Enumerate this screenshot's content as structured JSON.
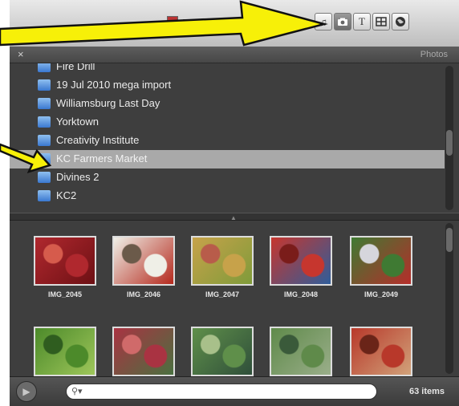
{
  "toolbar": {
    "level_meter": {
      "peak_color": "#b33333",
      "fill_color": "#2fa02f",
      "level_percent": 52
    },
    "tabs": [
      {
        "name": "music-tab",
        "icon": "music-note-icon",
        "active": false
      },
      {
        "name": "photos-tab",
        "icon": "camera-icon",
        "active": true
      },
      {
        "name": "titles-tab",
        "icon": "text-icon",
        "label": "T",
        "active": false
      },
      {
        "name": "transitions-tab",
        "icon": "transition-icon",
        "active": false
      },
      {
        "name": "maps-tab",
        "icon": "globe-icon",
        "active": false
      }
    ]
  },
  "header": {
    "close_label": "×",
    "title": "Photos"
  },
  "albums": [
    {
      "label": "Fire Drill",
      "selected": false
    },
    {
      "label": "19 Jul 2010 mega import",
      "selected": false
    },
    {
      "label": "Williamsburg Last Day",
      "selected": false
    },
    {
      "label": "Yorktown",
      "selected": false
    },
    {
      "label": "Creativity Institute",
      "selected": false
    },
    {
      "label": "KC Farmers Market",
      "selected": true
    },
    {
      "label": "Divines 2",
      "selected": false
    },
    {
      "label": "KC2",
      "selected": false
    }
  ],
  "photos": [
    {
      "label": "IMG_2045",
      "colors": [
        "#b0282e",
        "#6d1014",
        "#d65b4c"
      ]
    },
    {
      "label": "IMG_2046",
      "colors": [
        "#efefe7",
        "#b5291d",
        "#6b5a4a"
      ]
    },
    {
      "label": "IMG_2047",
      "colors": [
        "#c7a24a",
        "#7f9b3a",
        "#b85c4a"
      ]
    },
    {
      "label": "IMG_2048",
      "colors": [
        "#c6362e",
        "#2f5d9a",
        "#7a1c1a"
      ]
    },
    {
      "label": "IMG_2049",
      "colors": [
        "#3f7a33",
        "#b52d2a",
        "#d6d6dc"
      ]
    },
    {
      "label": "",
      "colors": [
        "#4c8a2a",
        "#9ec65a",
        "#2f5d1f"
      ]
    },
    {
      "label": "",
      "colors": [
        "#a93342",
        "#4a7040",
        "#d06a6a"
      ]
    },
    {
      "label": "",
      "colors": [
        "#5f8f4a",
        "#2f4f3a",
        "#a8c08a"
      ]
    },
    {
      "label": "",
      "colors": [
        "#5f8a4a",
        "#9aae8a",
        "#3a5a3a"
      ]
    },
    {
      "label": "",
      "colors": [
        "#b8382a",
        "#d1a27a",
        "#6a2418"
      ]
    }
  ],
  "search": {
    "placeholder": "",
    "value": ""
  },
  "status": {
    "count": "63 items"
  }
}
